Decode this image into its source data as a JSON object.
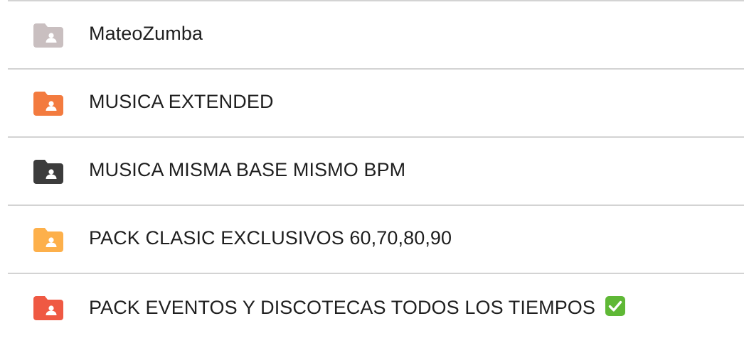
{
  "folders": [
    {
      "name": "MateoZumba",
      "icon": "shared-folder-icon",
      "color": "#c9bfc0"
    },
    {
      "name": "MUSICA EXTENDED",
      "icon": "shared-folder-icon",
      "color": "#f37b3f"
    },
    {
      "name": "MUSICA MISMA BASE MISMO BPM",
      "icon": "shared-folder-icon",
      "color": "#3c3c3c"
    },
    {
      "name": "PACK CLASIC EXCLUSIVOS 60,70,80,90",
      "icon": "shared-folder-icon",
      "color": "#fdb04b"
    },
    {
      "name": "PACK EVENTOS Y DISCOTECAS TODOS LOS TIEMPOS",
      "icon": "shared-folder-icon",
      "color": "#ef5943",
      "suffix": "✅"
    }
  ]
}
